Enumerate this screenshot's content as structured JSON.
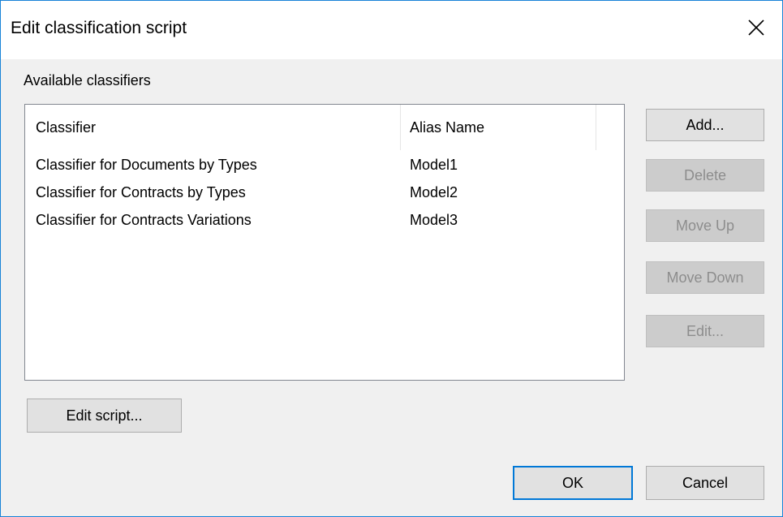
{
  "window": {
    "title": "Edit classification script"
  },
  "group": {
    "label": "Available classifiers"
  },
  "list": {
    "columns": [
      "Classifier",
      "Alias Name"
    ],
    "rows": [
      {
        "classifier": "Classifier for Documents by Types",
        "alias": "Model1"
      },
      {
        "classifier": "Classifier for Contracts by Types",
        "alias": "Model2"
      },
      {
        "classifier": "Classifier for Contracts Variations",
        "alias": "Model3"
      }
    ]
  },
  "side_buttons": {
    "add": "Add...",
    "delete": "Delete",
    "move_up": "Move Up",
    "move_down": "Move Down",
    "edit": "Edit..."
  },
  "edit_script_label": "Edit script...",
  "footer": {
    "ok": "OK",
    "cancel": "Cancel"
  },
  "colors": {
    "window_border": "#1883d7",
    "dialog_bg": "#f0f0f0",
    "default_button_border": "#0078d7",
    "disabled_text": "#8d8d8d"
  },
  "icons": {
    "close": "close-icon"
  }
}
